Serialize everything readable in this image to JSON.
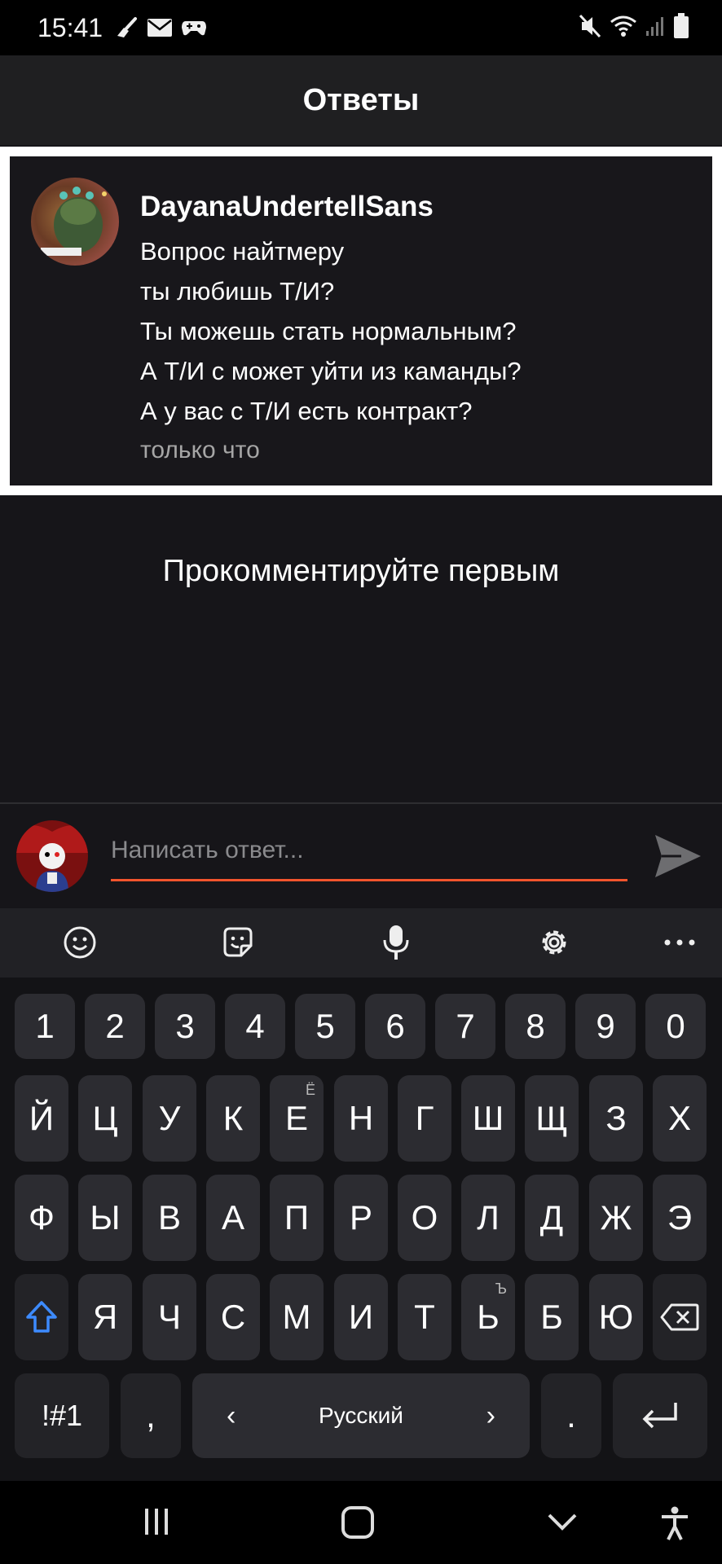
{
  "status_bar": {
    "time": "15:41",
    "left_icons": [
      "broom-icon",
      "mail-icon",
      "gamepad-icon"
    ],
    "right_icons": [
      "mute-icon",
      "wifi-icon",
      "signal-icon",
      "battery-icon"
    ]
  },
  "app_bar": {
    "title": "Ответы"
  },
  "post": {
    "author": "DayanaUndertellSans",
    "lines": [
      "Вопрос найтмеру",
      "ты любишь Т/И?",
      "Ты можешь стать нормальным?",
      "А Т/И с может уйти из каманды?",
      "А у вас с Т/И есть контракт?"
    ],
    "time": "только что"
  },
  "empty_state": "Прокомментируйте первым",
  "reply": {
    "placeholder": "Написать ответ..."
  },
  "keyboard": {
    "toolbar": [
      "emoji-icon",
      "sticker-icon",
      "mic-icon",
      "settings-icon",
      "more-icon"
    ],
    "row_numbers": [
      "1",
      "2",
      "3",
      "4",
      "5",
      "6",
      "7",
      "8",
      "9",
      "0"
    ],
    "row1": [
      "Й",
      "Ц",
      "У",
      "К",
      "Е",
      "Н",
      "Г",
      "Ш",
      "Щ",
      "З",
      "Х"
    ],
    "row1_hints": {
      "Е": "Ё"
    },
    "row2": [
      "Ф",
      "Ы",
      "В",
      "А",
      "П",
      "Р",
      "О",
      "Л",
      "Д",
      "Ж",
      "Э"
    ],
    "row3": [
      "Я",
      "Ч",
      "С",
      "М",
      "И",
      "Т",
      "Ь",
      "Б",
      "Ю"
    ],
    "row3_hints": {
      "Ь": "Ъ"
    },
    "symbols": "!#1",
    "comma": ",",
    "space_label": "Русский",
    "space_left": "‹",
    "space_right": "›",
    "period": "."
  },
  "accent_color": "#f2542d"
}
